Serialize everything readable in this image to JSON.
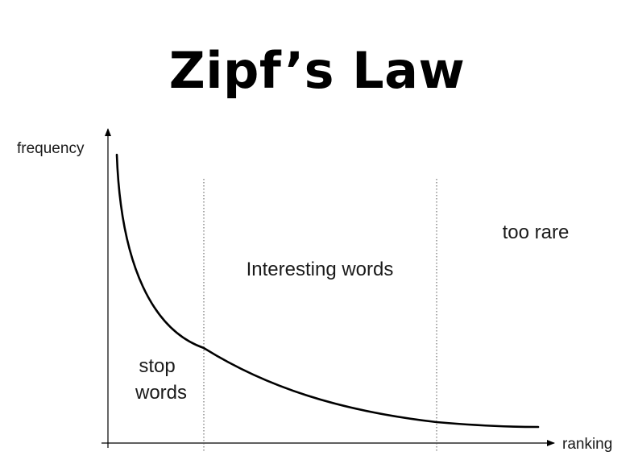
{
  "title": "Zipf’s Law",
  "axes": {
    "y_label": "frequency",
    "x_label": "ranking"
  },
  "regions": {
    "stop_words": [
      "stop",
      "words"
    ],
    "interesting": "Interesting words",
    "too_rare": "too rare"
  },
  "colors": {
    "ink": "#000000",
    "text": "#1a1a1a",
    "divider": "#555555"
  }
}
